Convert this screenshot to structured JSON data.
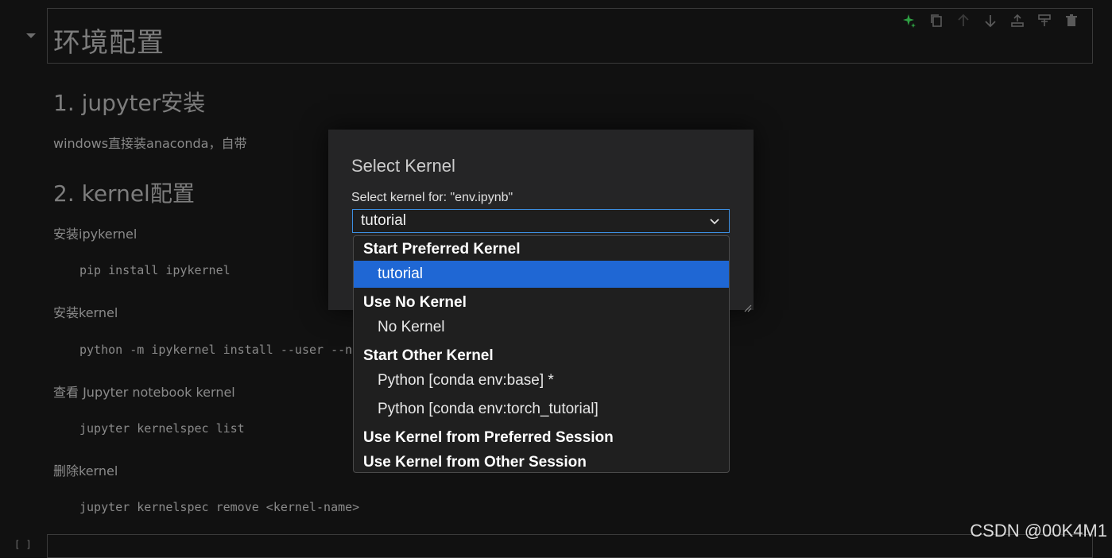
{
  "notebook": {
    "heading": "环境配置",
    "section1_heading": "1. jupyter安装",
    "section1_text": "windows直接装anaconda，自带",
    "section2_heading": "2. kernel配置",
    "step1_text": "安装ipykernel",
    "step1_code": "pip install ipykernel",
    "step2_text": "安装kernel",
    "step2_code": "python -m ipykernel install --user --n",
    "step3_text": "查看 Jupyter notebook kernel",
    "step3_code": "jupyter kernelspec list",
    "step4_text": "删除kernel",
    "step4_code": "jupyter kernelspec remove <kernel-name>",
    "exec_count": "[ ]"
  },
  "cell_toolbar": {
    "icons": [
      "sparkle-icon",
      "copy-icon",
      "arrow-up-icon",
      "arrow-down-icon",
      "insert-below-icon",
      "split-cell-icon",
      "trash-icon"
    ],
    "accent_color": "#2ea043"
  },
  "dialog": {
    "title": "Select Kernel",
    "label": "Select kernel for: \"env.ipynb\"",
    "selected_value": "tutorial"
  },
  "kernel_list": {
    "group_preferred": "Start Preferred Kernel",
    "opt_tutorial": "tutorial",
    "group_none": "Use No Kernel",
    "opt_none": "No Kernel",
    "group_other": "Start Other Kernel",
    "opt_base": "Python [conda env:base] *",
    "opt_torch": "Python [conda env:torch_tutorial]",
    "group_pref_session": "Use Kernel from Preferred Session",
    "group_other_session": "Use Kernel from Other Session",
    "highlight_color": "#1f67d4"
  },
  "watermark": "CSDN @00K4M1"
}
